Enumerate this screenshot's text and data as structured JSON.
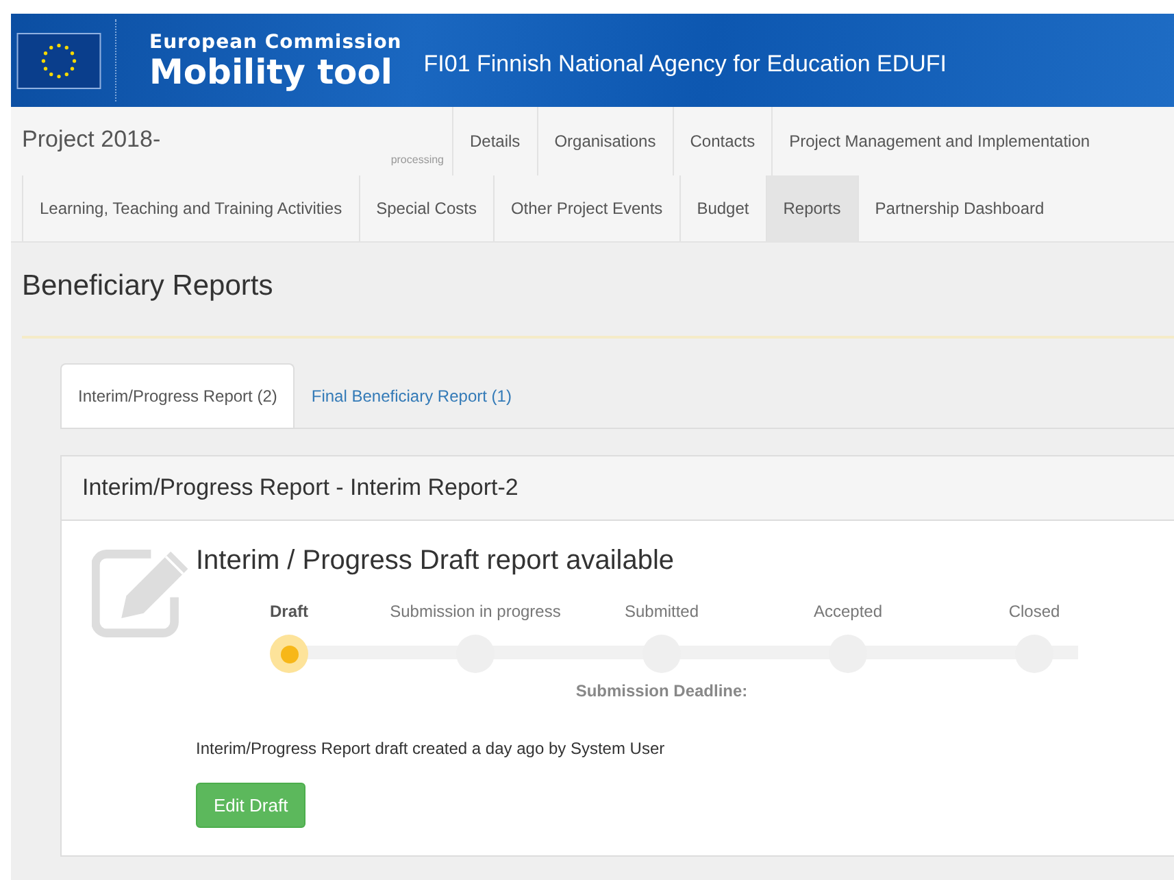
{
  "header": {
    "org_line": "European Commission",
    "app_name": "Mobility tool",
    "agency": "FI01 Finnish National Agency for Education EDUFI"
  },
  "project": {
    "title": "Project 2018-",
    "status": "processing"
  },
  "nav_rows": [
    [
      {
        "label": "Details",
        "selected": false
      },
      {
        "label": "Organisations",
        "selected": false
      },
      {
        "label": "Contacts",
        "selected": false
      },
      {
        "label": "Project Management and Implementation",
        "selected": false
      }
    ],
    [
      {
        "label": "Learning, Teaching and Training Activities",
        "selected": false
      },
      {
        "label": "Special Costs",
        "selected": false
      },
      {
        "label": "Other Project Events",
        "selected": false
      },
      {
        "label": "Budget",
        "selected": false
      },
      {
        "label": "Reports",
        "selected": true
      },
      {
        "label": "Partnership Dashboard",
        "selected": false
      }
    ]
  ],
  "page_title": "Beneficiary Reports",
  "report_tabs": [
    {
      "label": "Interim/Progress Report (2)",
      "selected": true
    },
    {
      "label": "Final Beneficiary Report (1)",
      "selected": false
    }
  ],
  "panel": {
    "title": "Interim/Progress Report - Interim Report-2",
    "heading": "Interim / Progress Draft report available",
    "steps": [
      {
        "label": "Draft",
        "current": true
      },
      {
        "label": "Submission in progress",
        "current": false
      },
      {
        "label": "Submitted",
        "current": false,
        "note": "Submission Deadline:"
      },
      {
        "label": "Accepted",
        "current": false
      },
      {
        "label": "Closed",
        "current": false
      }
    ],
    "message": "Interim/Progress Report draft created a day ago by System User",
    "button": "Edit Draft"
  }
}
